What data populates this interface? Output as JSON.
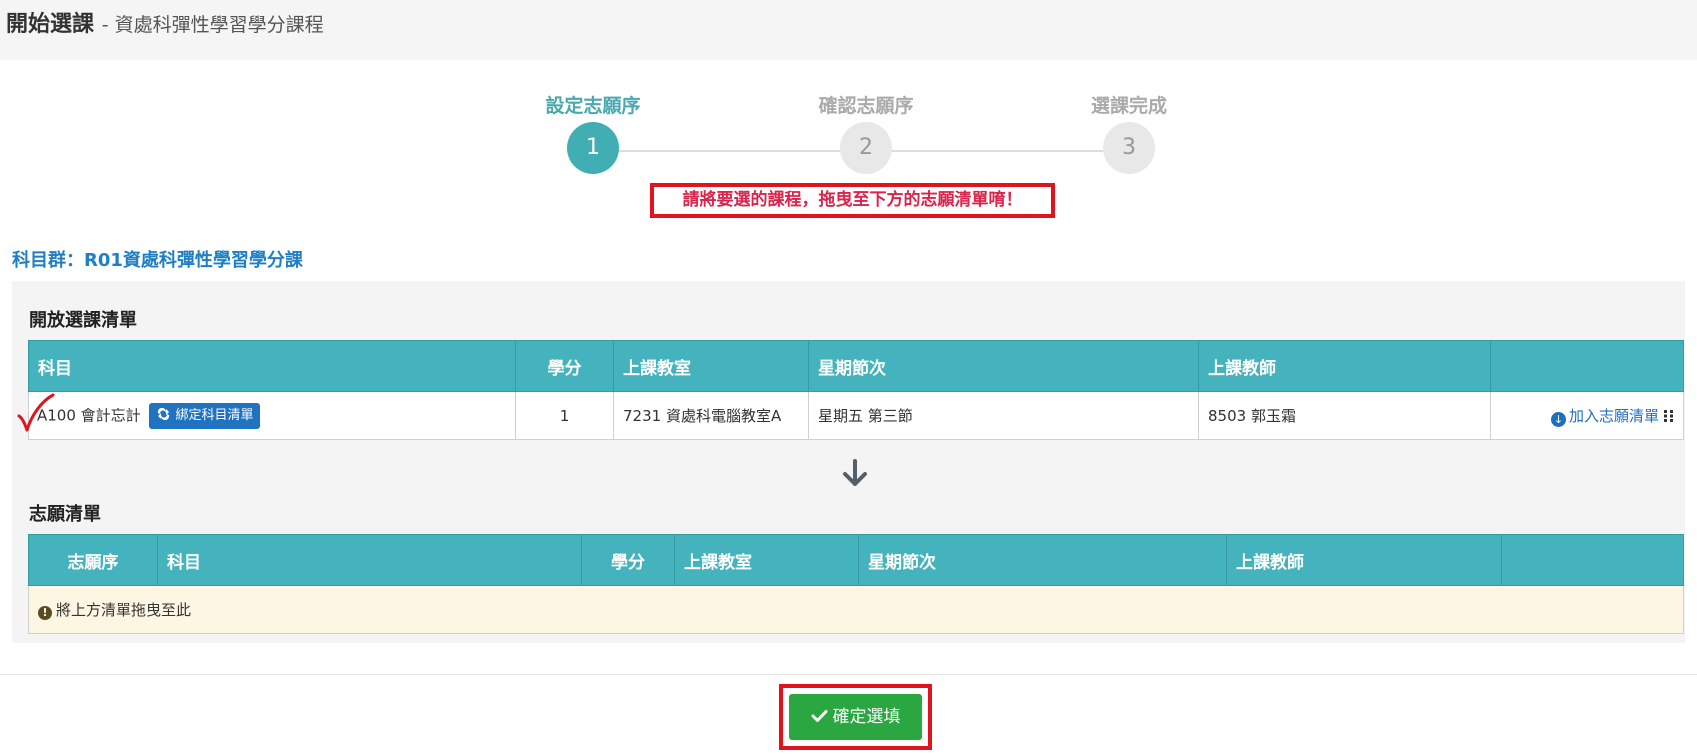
{
  "header": {
    "title": "開始選課",
    "subtitle": "- 資處科彈性學習學分課程"
  },
  "stepper": {
    "steps": [
      {
        "label": "設定志願序",
        "number": "1",
        "active": true
      },
      {
        "label": "確認志願序",
        "number": "2",
        "active": false
      },
      {
        "label": "選課完成",
        "number": "3",
        "active": false
      }
    ]
  },
  "hint": "請將要選的課程，拖曳至下方的志願清單唷！",
  "group_title": "科目群：R01資處科彈性學習學分課",
  "open_list": {
    "heading": "開放選課清單",
    "columns": [
      "科目",
      "學分",
      "上課教室",
      "星期節次",
      "上課教師",
      ""
    ],
    "rows": [
      {
        "subject": "A100 會計忘計",
        "bind_button": "綁定科目清單",
        "credits": "1",
        "classroom": "7231 資處科電腦教室A",
        "schedule": "星期五 第三節",
        "teacher": "8503 郭玉霜",
        "action": "加入志願清單"
      }
    ]
  },
  "wish_list": {
    "heading": "志願清單",
    "columns": [
      "志願序",
      "科目",
      "學分",
      "上課教室",
      "星期節次",
      "上課教師",
      ""
    ],
    "empty_message": "將上方清單拖曳至此"
  },
  "confirm_button": "確定選填",
  "colors": {
    "accent_teal": "#45b3bd",
    "link_blue": "#1f6fbf",
    "confirm_green": "#2aa740",
    "highlight_red": "#e0141e"
  },
  "icons": [
    "exchange-icon",
    "arrow-circle-down-icon",
    "grip-icon",
    "arrow-down-icon",
    "exclamation-circle-icon",
    "check-icon",
    "checkmark-annotation-icon"
  ]
}
